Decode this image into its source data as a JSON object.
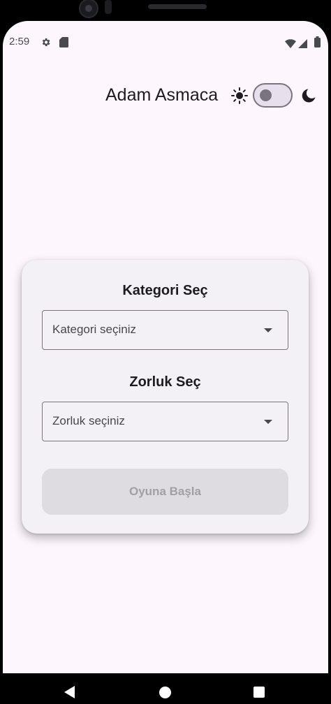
{
  "status_bar": {
    "time": "2:59",
    "icons": [
      "settings-icon",
      "sd-card-icon",
      "wifi-icon",
      "signal-icon",
      "battery-icon"
    ]
  },
  "header": {
    "title": "Adam Asmaca",
    "theme_toggle": {
      "state": "off",
      "left_icon": "sun-icon",
      "right_icon": "moon-icon"
    }
  },
  "form": {
    "category": {
      "title": "Kategori Seç",
      "placeholder": "Kategori seçiniz"
    },
    "difficulty": {
      "title": "Zorluk Seç",
      "placeholder": "Zorluk seçiniz"
    },
    "start_button": {
      "label": "Oyuna Başla",
      "state": "disabled"
    }
  },
  "navigation": {
    "buttons": [
      "back-icon",
      "home-icon",
      "recents-icon"
    ]
  },
  "colors": {
    "background": "#fdf7fd",
    "card": "#f4f1f6",
    "text": "#1d1b20",
    "outline": "#79747e",
    "button_disabled": "#dedce1"
  }
}
